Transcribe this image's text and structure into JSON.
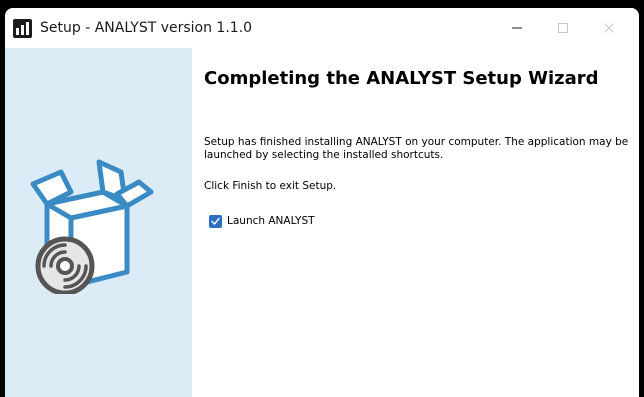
{
  "window": {
    "title": "Setup - ANALYST version 1.1.0"
  },
  "wizard": {
    "heading": "Completing the ANALYST Setup Wizard",
    "paragraph_1": "Setup has finished installing ANALYST on your computer. The application may be launched by selecting the installed shortcuts.",
    "paragraph_2": "Click Finish to exit Setup.",
    "launch_checkbox": {
      "label": "Launch ANALYST",
      "checked": true
    }
  },
  "icons": {
    "app": "setup-app-icon",
    "graphic": "box-with-disc-icon",
    "minimize": "minimize-icon",
    "maximize": "maximize-icon",
    "close": "close-icon",
    "check": "checkmark-icon"
  },
  "colors": {
    "sidebar_bg": "#dcecf6",
    "accent": "#2f6fc2",
    "illustration_stroke": "#3a8ac4"
  }
}
